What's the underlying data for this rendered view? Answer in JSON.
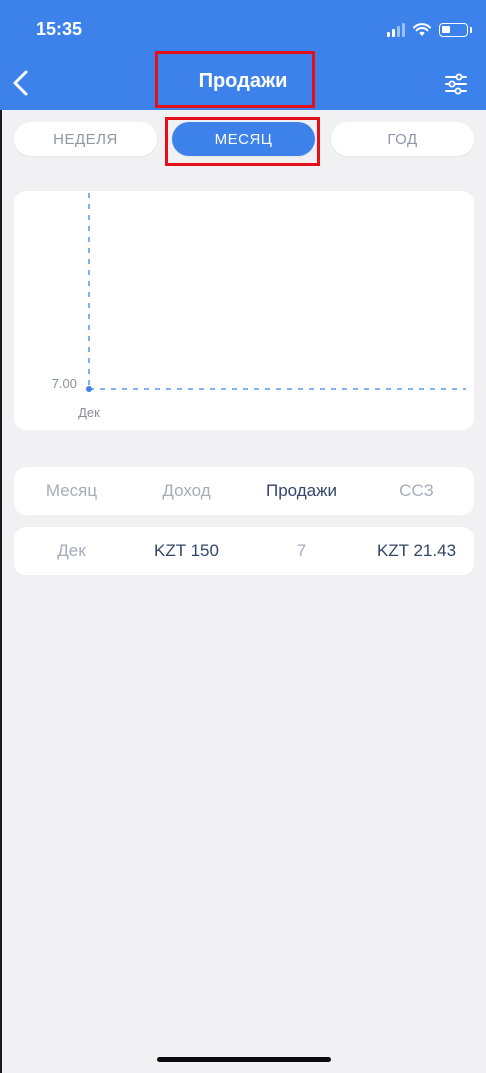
{
  "status_bar": {
    "time": "15:35"
  },
  "header": {
    "title": "Продажи"
  },
  "tabs": [
    {
      "label": "НЕДЕЛЯ",
      "selected": false
    },
    {
      "label": "МЕСЯЦ",
      "selected": true
    },
    {
      "label": "ГОД",
      "selected": false
    }
  ],
  "chart_data": {
    "type": "line",
    "categories": [
      "Дек"
    ],
    "values": [
      7.0
    ],
    "y_tick_labels": [
      "7.00"
    ],
    "grid": true
  },
  "table": {
    "columns": [
      "Месяц",
      "Доход",
      "Продажи",
      "ССЗ"
    ],
    "rows": [
      [
        "Дек",
        "KZT 150",
        "7",
        "KZT 21.43"
      ]
    ]
  },
  "colors": {
    "accent": "#3d82ea",
    "highlight": "#e4101a",
    "text_dark": "#32456a",
    "text_muted": "#a5acba"
  },
  "icons": {
    "back": "chevron-left-icon",
    "filter": "sliders-icon",
    "signal": "cellular-signal-icon",
    "wifi": "wifi-icon",
    "battery": "battery-icon"
  }
}
